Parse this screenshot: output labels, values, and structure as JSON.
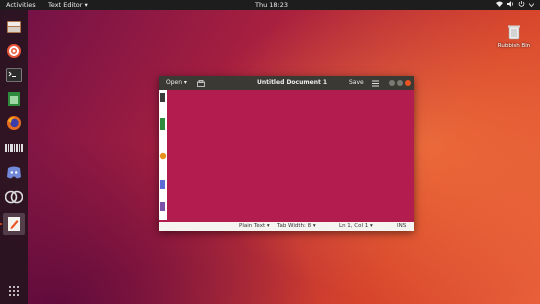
{
  "topbar": {
    "activities": "Activities",
    "app_menu": "Text Editor ▾",
    "clock": "Thu 18:23"
  },
  "desktop": {
    "rubbish_label": "Rubbish Bin"
  },
  "window": {
    "open_label": "Open ▾",
    "title": "Untitled Document 1",
    "save_label": "Save",
    "status": {
      "language": "Plain Text ▾",
      "tab_width": "Tab Width: 8 ▾",
      "position": "Ln 1, Col 1 ▾",
      "mode": "INS"
    }
  },
  "colors": {
    "accent": "#e95420",
    "window_bg": "#b21c4e",
    "titlebar": "#3a3934"
  }
}
